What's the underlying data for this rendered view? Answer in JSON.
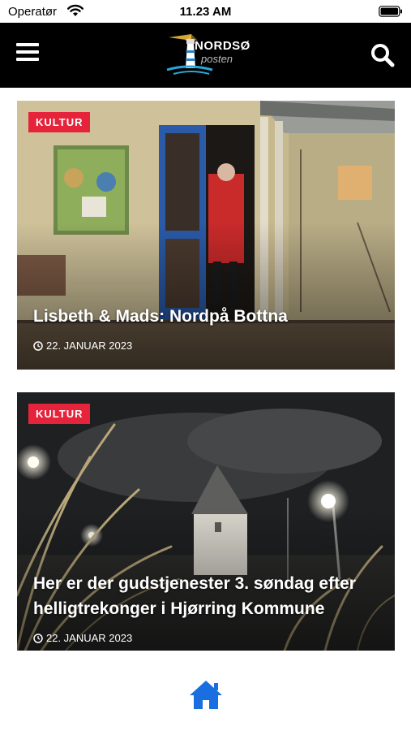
{
  "status_bar": {
    "carrier": "Operatør",
    "time": "11.23 AM",
    "icons": [
      "wifi-icon",
      "battery-icon"
    ]
  },
  "header": {
    "logo_line1": "NORDSØ",
    "logo_line2": "posten",
    "icons": [
      "hamburger-menu-icon",
      "search-icon"
    ],
    "background": "#000000"
  },
  "articles": [
    {
      "category": "KULTUR",
      "title": "Lisbeth & Mads: Nordpå Bottna",
      "date": "22. JANUAR 2023"
    },
    {
      "category": "KULTUR",
      "title": "Her er der gudstjenester 3. søndag efter helligtrekonger i Hjørring Kommune",
      "date": "22. JANUAR 2023"
    }
  ],
  "colors": {
    "badge": "#e5243b",
    "home_icon": "#1a6fe0"
  },
  "bottom_nav": {
    "icons": [
      "home-icon"
    ]
  }
}
